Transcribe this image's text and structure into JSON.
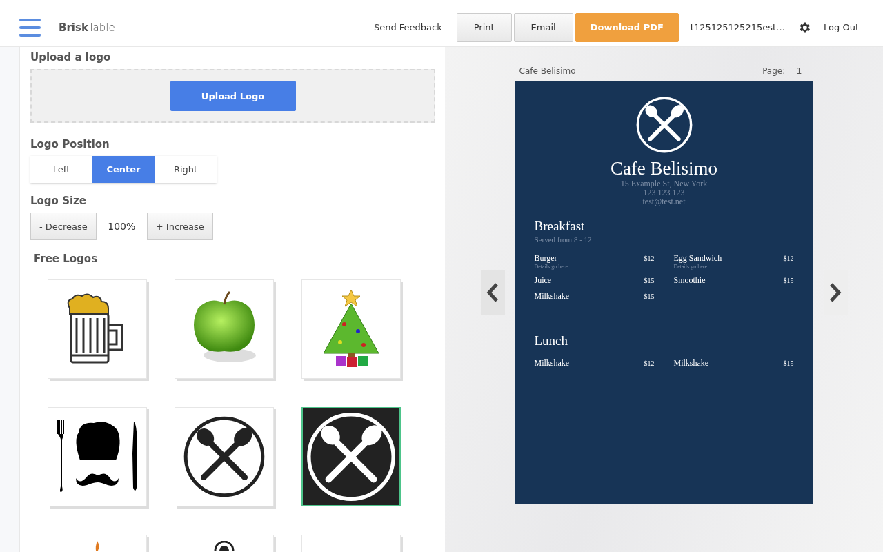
{
  "header": {
    "brand": "**Brisk**Table",
    "send_feedback": "Send Feedback",
    "buttons": [
      {
        "label": "Print",
        "kind": "plain"
      },
      {
        "label": "Email",
        "kind": "plain"
      },
      {
        "label": "Download PDF",
        "kind": "primary"
      }
    ],
    "user": "t125125125215est…",
    "logout": "Log Out"
  },
  "editor": {
    "upload_title": "Upload a logo",
    "upload_button": "Upload Logo",
    "position_title": "Logo Position",
    "positions": [
      {
        "label": "Left",
        "selected": false
      },
      {
        "label": "Center",
        "selected": true
      },
      {
        "label": "Right",
        "selected": false
      }
    ],
    "size_title": "Logo Size",
    "decrease": "- Decrease",
    "size_value": "100%",
    "increase": "+ Increase",
    "free_logos_title": "Free Logos",
    "logos": [
      {
        "kind": "beer",
        "selected": false
      },
      {
        "kind": "apple",
        "selected": false
      },
      {
        "kind": "tree",
        "selected": false
      },
      {
        "kind": "chef",
        "selected": false
      },
      {
        "kind": "cutlery-light",
        "selected": false
      },
      {
        "kind": "cutlery-dark",
        "selected": true
      },
      {
        "kind": "flame",
        "selected": false
      },
      {
        "kind": "wheel",
        "selected": false
      },
      {
        "kind": "blank",
        "selected": false
      }
    ]
  },
  "preview": {
    "document_name": "Cafe Belisimo",
    "page_label": "Page:",
    "page_number": "1",
    "menu": {
      "title": "Cafe Belisimo",
      "address": "15 Example St, New York",
      "phone": "123 123 123",
      "email": "test@test.net",
      "sections": [
        {
          "title": "Breakfast",
          "subtitle": "Served from 8 - 12",
          "items": [
            {
              "name": "Burger",
              "price": "$12",
              "details": "Details go here"
            },
            {
              "name": "Egg Sandwich",
              "price": "$12",
              "details": "Details go here"
            },
            {
              "name": "Juice",
              "price": "$15"
            },
            {
              "name": "Smoothie",
              "price": "$15"
            },
            {
              "name": "Milkshake",
              "price": "$15"
            }
          ]
        },
        {
          "title": "Lunch",
          "items": [
            {
              "name": "Milkshake",
              "price": "$12"
            },
            {
              "name": "Milkshake",
              "price": "$15"
            }
          ]
        }
      ]
    }
  }
}
